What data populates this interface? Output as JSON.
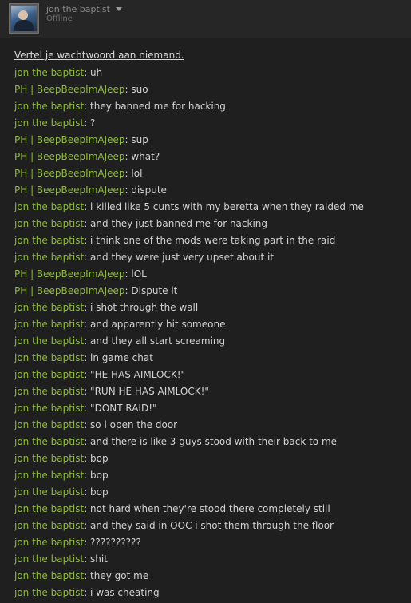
{
  "header": {
    "username": "jon the baptist",
    "status": "Offline"
  },
  "warning": "Vertel je wachtwoord aan niemand.",
  "messages": [
    {
      "sender": "jon the baptist",
      "text": "uh"
    },
    {
      "sender": "PH | BeepBeepImAJeep",
      "text": "suo"
    },
    {
      "sender": "jon the baptist",
      "text": "they banned me for hacking"
    },
    {
      "sender": "jon the baptist",
      "text": "?"
    },
    {
      "sender": "PH | BeepBeepImAJeep",
      "text": "sup"
    },
    {
      "sender": "PH | BeepBeepImAJeep",
      "text": "what?"
    },
    {
      "sender": "PH | BeepBeepImAJeep",
      "text": "lol"
    },
    {
      "sender": "PH | BeepBeepImAJeep",
      "text": "dispute"
    },
    {
      "sender": "jon the baptist",
      "text": "i killed like 5 cunts with my beretta when they raided me"
    },
    {
      "sender": "jon the baptist",
      "text": "and they just banned me for hacking"
    },
    {
      "sender": "jon the baptist",
      "text": "i think one of the mods were taking part in the raid"
    },
    {
      "sender": "jon the baptist",
      "text": "and they were just very upset about it"
    },
    {
      "sender": "PH | BeepBeepImAJeep",
      "text": "lOL"
    },
    {
      "sender": "PH | BeepBeepImAJeep",
      "text": "Dispute it"
    },
    {
      "sender": "jon the baptist",
      "text": "i shot through the wall"
    },
    {
      "sender": "jon the baptist",
      "text": "and apparently hit someone"
    },
    {
      "sender": "jon the baptist",
      "text": "and they all start screaming"
    },
    {
      "sender": "jon the baptist",
      "text": "in game chat"
    },
    {
      "sender": "jon the baptist",
      "text": "\"HE HAS AIMLOCK!\""
    },
    {
      "sender": "jon the baptist",
      "text": "\"RUN HE HAS AIMLOCK!\""
    },
    {
      "sender": "jon the baptist",
      "text": "\"DONT RAID!\""
    },
    {
      "sender": "jon the baptist",
      "text": "so i open the door"
    },
    {
      "sender": "jon the baptist",
      "text": "and there is like 3 guys stood with their back to me"
    },
    {
      "sender": "jon the baptist",
      "text": "bop"
    },
    {
      "sender": "jon the baptist",
      "text": "bop"
    },
    {
      "sender": "jon the baptist",
      "text": "bop"
    },
    {
      "sender": "jon the baptist",
      "text": "not hard when they're stood there completely still"
    },
    {
      "sender": "jon the baptist",
      "text": "and they said in OOC i shot them through the floor"
    },
    {
      "sender": "jon the baptist",
      "text": "??????????"
    },
    {
      "sender": "jon the baptist",
      "text": "shit"
    },
    {
      "sender": "jon the baptist",
      "text": "they got me"
    },
    {
      "sender": "jon the baptist",
      "text": "i was cheating"
    }
  ],
  "colors": {
    "background": "#1f1f1f",
    "sender_name": "#8fb93b",
    "message_text": "#d2d2d2",
    "status_text": "#6f6f6f"
  }
}
